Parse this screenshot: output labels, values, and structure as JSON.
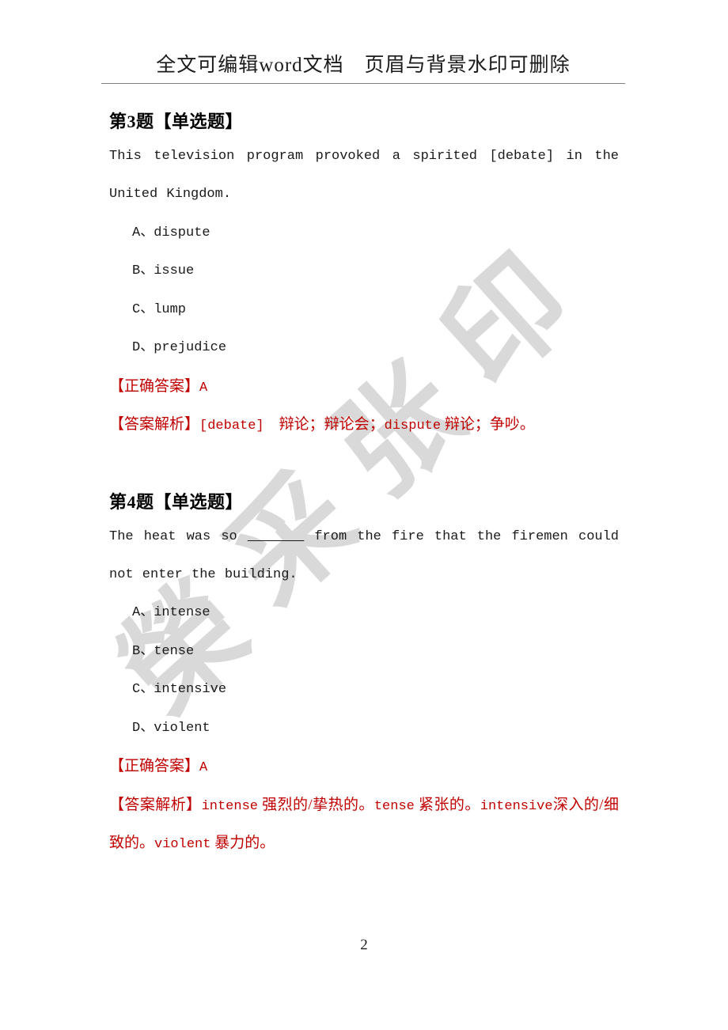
{
  "header": {
    "text": "全文可编辑word文档　页眉与背景水印可删除"
  },
  "watermark": {
    "chars": [
      "印",
      "张",
      "采",
      "榮"
    ],
    "color": "#d9d9d9"
  },
  "colors": {
    "answer_red": "#c00000",
    "body_text": "#1a1a1a",
    "rule": "#808080"
  },
  "questions": [
    {
      "title": "第3题【单选题】",
      "stem": "This television program provoked a spirited [debate] in the United Kingdom.",
      "options": [
        "A、dispute",
        "B、issue",
        "C、lump",
        "D、prejudice"
      ],
      "answer_tag": "【正确答案】",
      "answer_value": "A",
      "explain_tag": "【答案解析】",
      "explain_mono": "[debate]",
      "explain_text": "　辩论；辩论会；",
      "explain_mono2": "dispute",
      "explain_text2": " 辩论；争吵。"
    },
    {
      "title": "第4题【单选题】",
      "stem_before": "The heat was so ",
      "stem_blank": "_______",
      "stem_after": " from the fire that the firemen could not enter the building.",
      "options": [
        "A、intense",
        "B、tense",
        "C、intensive",
        "D、violent"
      ],
      "answer_tag": "【正确答案】",
      "answer_value": "A",
      "explain_tag": "【答案解析】",
      "explain_mono": "intense",
      "explain_text": " 强烈的/挚热的。",
      "explain_mono2": "tense",
      "explain_text2": " 紧张的。",
      "explain_mono3": "intensive",
      "explain_text3": "深入的/细致的。",
      "explain_mono4": "violent",
      "explain_text4": " 暴力的。"
    }
  ],
  "footer": {
    "page_number": "2"
  }
}
